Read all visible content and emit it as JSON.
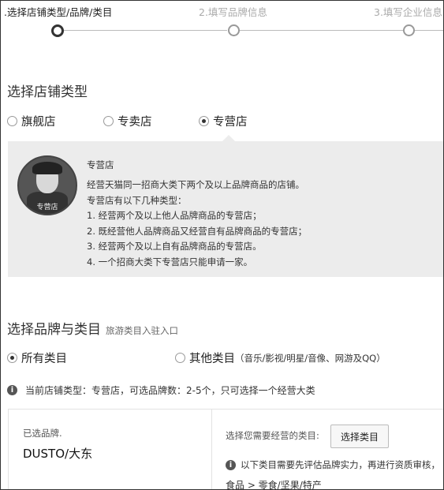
{
  "steps": [
    {
      "label": ".选择店铺类型/品牌/类目",
      "active": true
    },
    {
      "label": "2.填写品牌信息",
      "active": false
    },
    {
      "label": "3.填写企业信息",
      "active": false
    }
  ],
  "store_type": {
    "title": "选择店铺类型",
    "options": [
      "旗舰店",
      "专卖店",
      "专营店"
    ],
    "selected": "专营店",
    "info": {
      "avatar_label": "专营店",
      "title": "专营店",
      "lines": [
        "经营天猫同一招商大类下两个及以上品牌商品的店铺。",
        "专营店有以下几种类型：",
        "1. 经营两个及以上他人品牌商品的专营店；",
        "2. 既经营他人品牌商品又经营自有品牌商品的专营店；",
        "3. 经营两个及以上自有品牌商品的专营店。",
        "4. 一个招商大类下专营店只能申请一家。"
      ]
    }
  },
  "brand_category": {
    "title": "选择品牌与类目",
    "subtitle": "旅游类目入驻入口",
    "options": [
      {
        "label": "所有类目",
        "detail": "",
        "checked": true
      },
      {
        "label": "其他类目",
        "detail": "（音乐/影视/明星/音像、网游及QQ）",
        "checked": false
      }
    ],
    "note": "当前店铺类型：专营店，可选品牌数：2-5个，只可选择一个经营大类",
    "selected_label": "已选品牌.",
    "selected_brand": "DUSTO/大东",
    "prompt": "选择您需要经营的类目:",
    "select_button": "选择类目",
    "warning": "以下类目需要先评估品牌实力，再进行资质审核，",
    "category_path": "食品 > 零食/坚果/特产"
  }
}
